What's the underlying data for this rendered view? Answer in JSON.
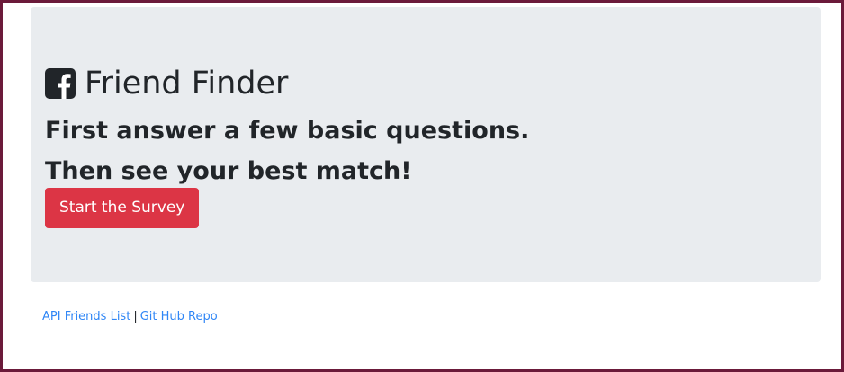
{
  "hero": {
    "icon": "facebook-square-icon",
    "title": "Friend Finder",
    "subtitle_line1": "First answer a few basic questions.",
    "subtitle_line2": "Then see your best match!",
    "start_button_label": "Start the Survey",
    "background_color": "#e9ecef",
    "button_color": "#dc3545"
  },
  "footer": {
    "api_link_label": "API Friends List",
    "separator": "|",
    "repo_link_label": "Git Hub Repo",
    "link_color": "#2f86f6"
  },
  "frame": {
    "border_color": "#6b1a3a"
  }
}
